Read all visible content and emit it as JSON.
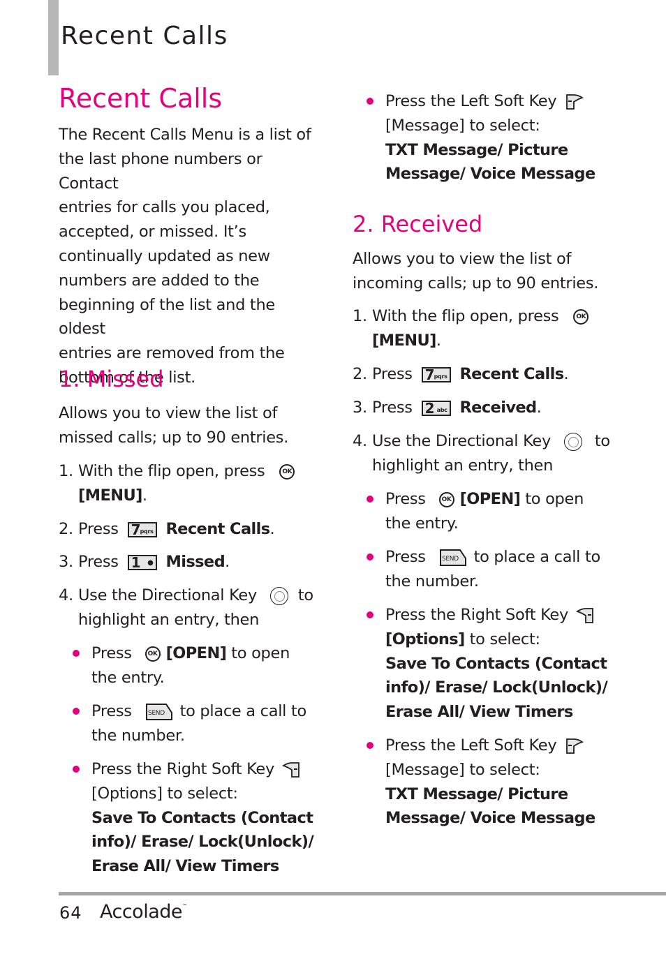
{
  "header": {
    "section_title": "Recent Calls"
  },
  "page_title": "Recent Calls",
  "intro": "The Recent Calls Menu is a list of the last phone numbers or Contact entries for calls you placed, accepted, or missed. It’s continually updated as new numbers are added to the beginning of the list and the oldest entries are removed from the bottom of the list.",
  "intro_lines": [
    "The Recent Calls Menu is a list of",
    "the last phone numbers or Contact",
    "entries for calls you placed,",
    "accepted, or missed. It’s",
    "continually updated as new",
    "numbers are added to the",
    "beginning of the list and the oldest",
    "entries are removed from the",
    "bottom of the list."
  ],
  "sections": [
    {
      "heading": "1. Missed",
      "desc_lines": [
        "Allows you to view the list of",
        "missed calls; up to 90 entries."
      ],
      "steps": [
        {
          "num": "1.",
          "pre": "With the flip open, press",
          "key": "ok-key",
          "key_label": "OK",
          "bold": "[MENU]",
          "post": "."
        },
        {
          "num": "2.",
          "pre": "Press",
          "key": "7-key",
          "key_big": "7",
          "key_small": "pqrs",
          "bold": "Recent Calls",
          "post": "."
        },
        {
          "num": "3.",
          "pre": "Press",
          "key": "1-key",
          "key_big": "1",
          "key_small": "voicemail",
          "bold": "Missed",
          "post": "."
        },
        {
          "num": "4.",
          "pre": "Use the Directional Key",
          "key": "directional-key",
          "post": "to",
          "cont": "highlight an entry, then"
        }
      ],
      "bullets": [
        {
          "pre": "Press",
          "key_label": "OK",
          "bold": "[OPEN]",
          "post": "to open",
          "cont": "the entry."
        },
        {
          "pre": "Press",
          "key_label": "SEND",
          "post": "to place a call to",
          "cont": "the number."
        },
        {
          "pre": "Press the Right Soft Key",
          "line2": "[Options] to select:",
          "bold_lines": [
            "Save To Contacts (Contact",
            "info)/ Erase/ Lock(Unlock)/",
            "Erase All/ View Timers"
          ]
        }
      ]
    },
    {
      "heading": "2. Received",
      "pre_bullet": {
        "pre": "Press the Left Soft Key",
        "line2": "[Message] to select:",
        "bold_lines": [
          "TXT Message/ Picture",
          "Message/ Voice Message"
        ]
      },
      "desc_lines": [
        "Allows you to view the list of",
        "incoming calls; up to 90 entries."
      ],
      "steps": [
        {
          "num": "1.",
          "pre": "With the flip open, press",
          "key": "ok-key",
          "key_label": "OK",
          "bold": "[MENU]",
          "post": "."
        },
        {
          "num": "2.",
          "pre": "Press",
          "key": "7-key",
          "key_big": "7",
          "key_small": "pqrs",
          "bold": "Recent Calls",
          "post": "."
        },
        {
          "num": "3.",
          "pre": "Press",
          "key": "2-key",
          "key_big": "2",
          "key_small": "abc",
          "bold": "Received",
          "post": "."
        },
        {
          "num": "4.",
          "pre": "Use the Directional Key",
          "key": "directional-key",
          "post": "to",
          "cont": "highlight an entry, then"
        }
      ],
      "bullets": [
        {
          "pre": "Press",
          "key_label": "OK",
          "bold": "[OPEN]",
          "post": "to open",
          "cont": "the entry."
        },
        {
          "pre": "Press",
          "key_label": "SEND",
          "post": "to place a call to",
          "cont": "the number."
        },
        {
          "pre": "Press the Right Soft Key",
          "line2_bold": "[Options]",
          "line2_post": "to select:",
          "bold_lines": [
            "Save To Contacts (Contact",
            "info)/ Erase/ Lock(Unlock)/",
            "Erase All/ View Timers"
          ]
        },
        {
          "pre": "Press the Left Soft Key",
          "line2": "[Message] to select:",
          "bold_lines": [
            "TXT Message/ Picture",
            "Message/ Voice Message"
          ]
        }
      ]
    }
  ],
  "footer": {
    "page_number": "64",
    "brand": "Accolade",
    "trademark": "™"
  },
  "colors": {
    "accent": "#e5007e",
    "text": "#231f20",
    "rule": "#a6a6a6",
    "header_bar": "#b7b7b7"
  }
}
